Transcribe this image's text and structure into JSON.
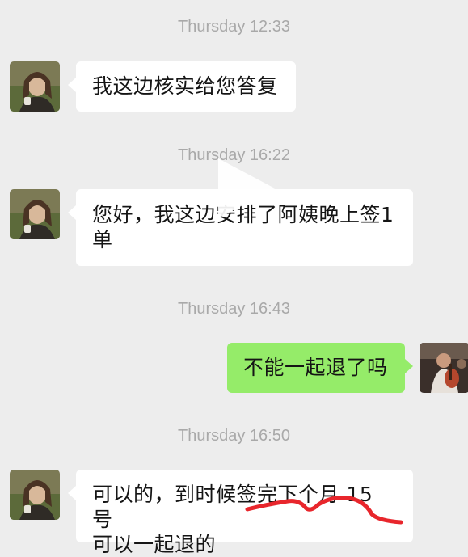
{
  "messages": [
    {
      "timestamp": "Thursday 12:33",
      "sender": "other",
      "text": "我这边核实给您答复"
    },
    {
      "timestamp": "Thursday 16:22",
      "sender": "other",
      "lines": [
        "您好，我这边安排了阿姨晚上签1",
        "单"
      ]
    },
    {
      "timestamp": "Thursday 16:43",
      "sender": "self",
      "text": "不能一起退了吗"
    },
    {
      "timestamp": "Thursday 16:50",
      "sender": "other",
      "lines": [
        "可以的，到时候签完下个月 15 号",
        "可以一起退的"
      ]
    }
  ],
  "colors": {
    "background": "#ededed",
    "incoming_bubble": "#ffffff",
    "outgoing_bubble": "#95ec69",
    "timestamp_text": "#a9a9a9",
    "annotation_stroke": "#e8262c"
  },
  "overlay": {
    "icon": "play-icon"
  }
}
